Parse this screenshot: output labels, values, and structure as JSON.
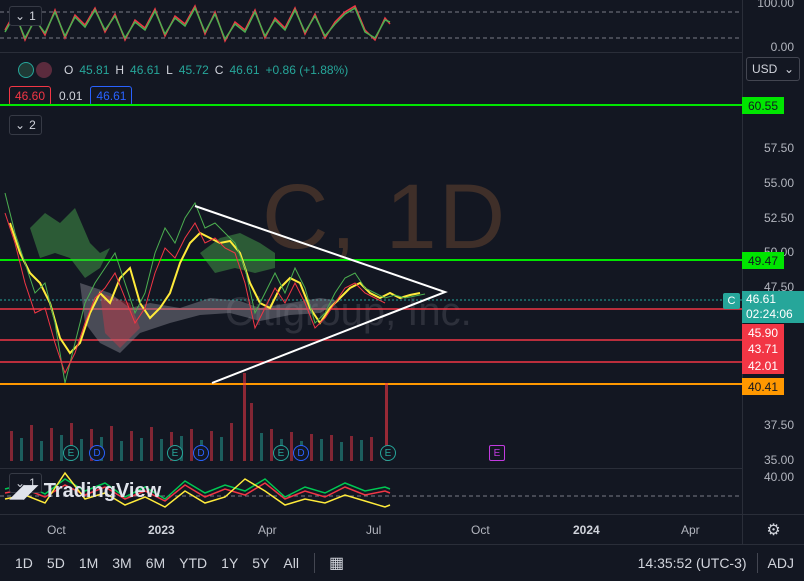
{
  "pane1": {
    "toggle_count": "1",
    "scale": [
      "100.00",
      "0.00"
    ]
  },
  "pane3": {
    "toggle_count": "1",
    "scale": [
      "40.00"
    ]
  },
  "legend": {
    "open_label": "O",
    "open": "45.81",
    "high_label": "H",
    "high": "46.61",
    "low_label": "L",
    "low": "45.72",
    "close_label": "C",
    "close": "46.61",
    "change": "+0.86 (+1.88%)",
    "indicators_count": "2"
  },
  "bidask": {
    "sell": "46.60",
    "spread": "0.01",
    "buy": "46.61"
  },
  "currency": "USD",
  "watermark": {
    "symbol": "C, 1D",
    "name": "Citigroup, Inc."
  },
  "price_ticks": [
    "57.50",
    "55.00",
    "52.50",
    "50.00",
    "47.50",
    "37.50",
    "35.00"
  ],
  "price_labels": [
    {
      "value": "60.55",
      "color": "#00e600"
    },
    {
      "value": "49.47",
      "color": "#00e600"
    },
    {
      "value": "45.90",
      "color": "#f23645"
    },
    {
      "value": "43.71",
      "color": "#f23645"
    },
    {
      "value": "42.01",
      "color": "#f23645"
    },
    {
      "value": "40.41",
      "color": "#ff9800"
    }
  ],
  "current": {
    "symbol": "C",
    "price": "46.61",
    "countdown": "02:24:06"
  },
  "time_ticks": [
    {
      "label": "Oct",
      "bold": false
    },
    {
      "label": "2023",
      "bold": true
    },
    {
      "label": "Apr",
      "bold": false
    },
    {
      "label": "Jul",
      "bold": false
    },
    {
      "label": "Oct",
      "bold": false
    },
    {
      "label": "2024",
      "bold": true
    },
    {
      "label": "Apr",
      "bold": false
    }
  ],
  "events": [
    "E",
    "D",
    "E",
    "D",
    "E",
    "D",
    "E",
    "E"
  ],
  "logo": "TradingView",
  "timeframes": [
    "1D",
    "5D",
    "1M",
    "3M",
    "6M",
    "YTD",
    "1Y",
    "5Y",
    "All"
  ],
  "clock": "14:35:52 (UTC-3)",
  "adj": "ADJ",
  "colors": {
    "bg": "#131722",
    "up": "#26a69a",
    "down": "#f23645",
    "green_line": "#00e600",
    "orange_line": "#ff9800"
  }
}
